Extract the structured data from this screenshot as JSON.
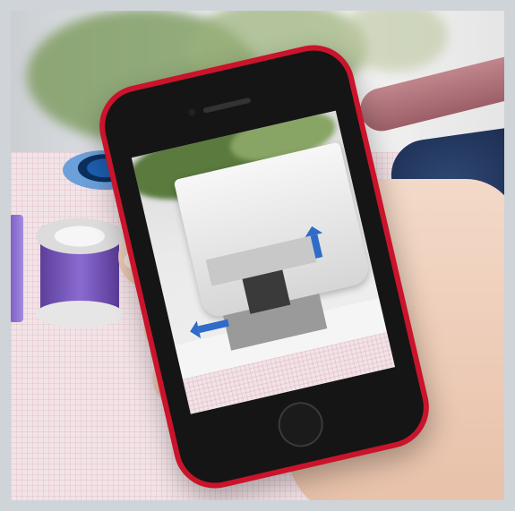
{
  "scene": {
    "objects": [
      "plant",
      "spool-blue",
      "spool-purple",
      "denim-fabric",
      "cutting-board",
      "smartphone",
      "hand"
    ]
  },
  "phone": {
    "color": "#c9142b",
    "screen_content": "sewing-machine-ar-view"
  },
  "colors": {
    "arrow": "#2f6bc9",
    "spool": "#8a6bd0",
    "tablecloth": "#f2e3e6"
  },
  "icons": [
    "arrow-left-icon",
    "arrow-up-icon"
  ]
}
